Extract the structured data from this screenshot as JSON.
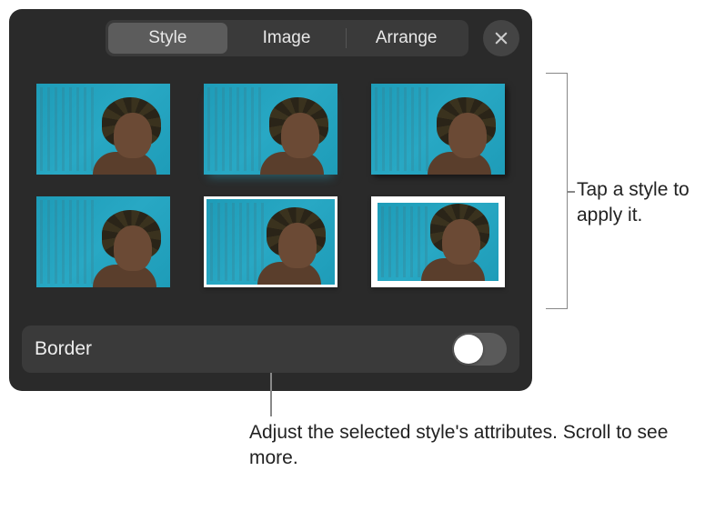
{
  "tabs": {
    "style": "Style",
    "image": "Image",
    "arrange": "Arrange",
    "active": "style"
  },
  "close_icon": "close",
  "styles_grid": {
    "items": [
      {
        "variant": "plain"
      },
      {
        "variant": "reflection"
      },
      {
        "variant": "shadow"
      },
      {
        "variant": "plain"
      },
      {
        "variant": "white-border"
      },
      {
        "variant": "thick-white-border"
      }
    ]
  },
  "border_control": {
    "label": "Border",
    "value": false
  },
  "callouts": {
    "right": "Tap a style to apply it.",
    "bottom": "Adjust the selected style's attributes. Scroll to see more."
  }
}
